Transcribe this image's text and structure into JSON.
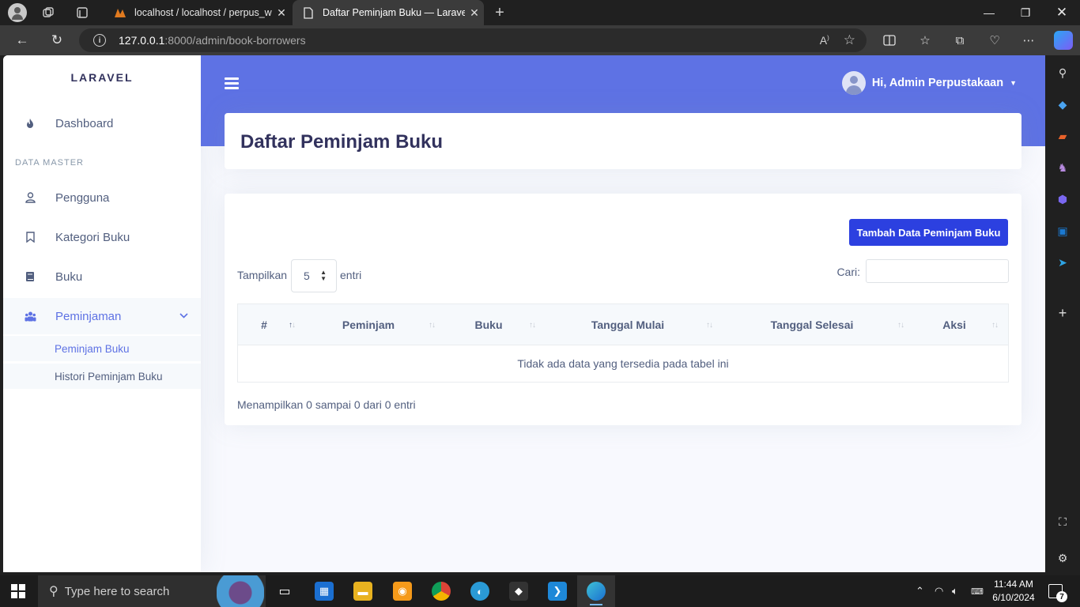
{
  "browser": {
    "tabs": [
      {
        "title": "localhost / localhost / perpus_we",
        "icon": "phpmyadmin-icon"
      },
      {
        "title": "Daftar Peminjam Buku — Laravel",
        "icon": "page-icon"
      }
    ],
    "url_host": "127.0.0.1",
    "url_rest": ":8000/admin/book-borrowers"
  },
  "sidebar": {
    "brand": "LARAVEL",
    "dashboard": "Dashboard",
    "heading": "DATA MASTER",
    "items": [
      {
        "label": "Pengguna",
        "icon": "user-icon"
      },
      {
        "label": "Kategori Buku",
        "icon": "bookmark-icon"
      },
      {
        "label": "Buku",
        "icon": "book-icon"
      },
      {
        "label": "Peminjaman",
        "icon": "users-icon"
      }
    ],
    "subitems": [
      {
        "label": "Peminjam Buku"
      },
      {
        "label": "Histori Peminjam Buku"
      }
    ]
  },
  "header": {
    "user_greeting": "Hi, Admin Perpustakaan"
  },
  "page": {
    "title": "Daftar Peminjam Buku",
    "add_button": "Tambah Data Peminjam Buku",
    "length_label": "Tampilkan",
    "length_value": "5",
    "length_suffix": "entri",
    "search_label": "Cari:",
    "columns": [
      "#",
      "Peminjam",
      "Buku",
      "Tanggal Mulai",
      "Tanggal Selesai",
      "Aksi"
    ],
    "empty_text": "Tidak ada data yang tersedia pada tabel ini",
    "info": "Menampilkan 0 sampai 0 dari 0 entri"
  },
  "taskbar": {
    "search_placeholder": "Type here to search",
    "time": "11:44 AM",
    "date": "6/10/2024",
    "notifications": "7"
  },
  "colors": {
    "primary": "#5e72e4",
    "button": "#2c40e0"
  }
}
